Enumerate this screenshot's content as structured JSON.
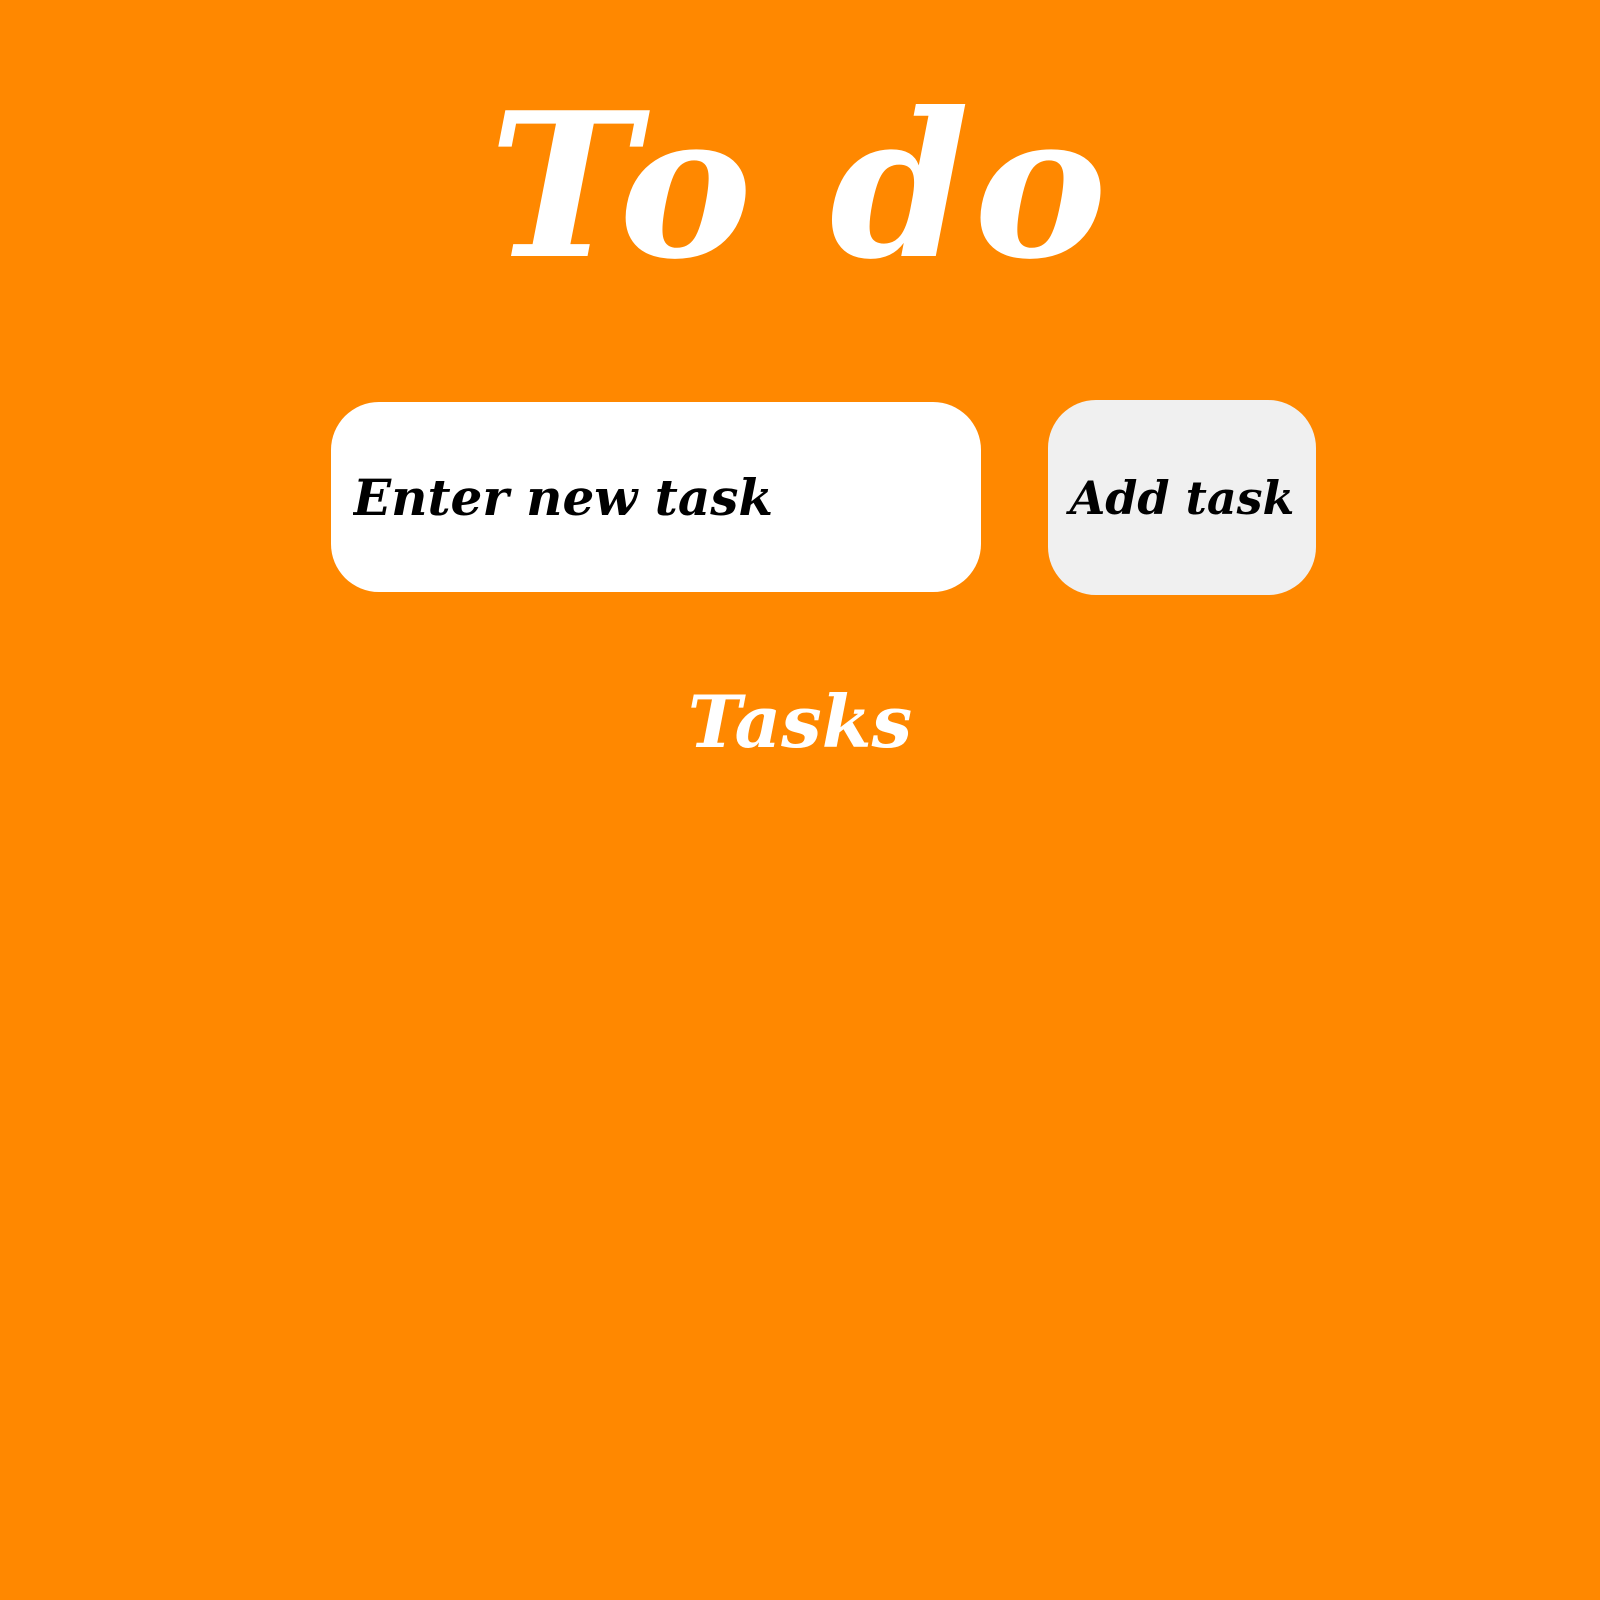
{
  "app": {
    "title": "To do"
  },
  "form": {
    "input_value": "",
    "input_placeholder": "Enter new task",
    "add_button_label": "Add task"
  },
  "tasks": {
    "heading": "Tasks",
    "items": []
  },
  "colors": {
    "background": "#ff8800",
    "title_text": "#ffffff",
    "input_background": "#ffffff",
    "button_background": "#f0f0f0",
    "control_text": "#000000"
  }
}
